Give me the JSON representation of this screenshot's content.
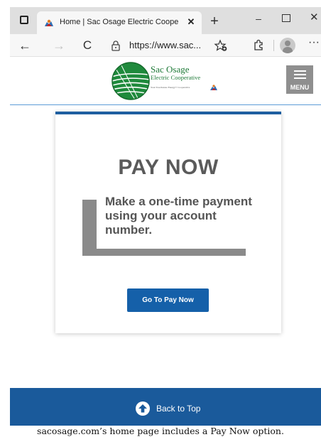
{
  "browser": {
    "tab_title": "Home | Sac Osage Electric Coope",
    "tab_close": "✕",
    "new_tab": "+",
    "minimize": "–",
    "close_window": "✕",
    "back": "←",
    "forward": "→",
    "refresh": "C",
    "url": "https://www.sac...",
    "more": "···"
  },
  "site": {
    "logo_name": "Sac Osage",
    "logo_subtitle": "Electric Cooperative",
    "logo_tagline": "Your Touchstone Energy® Cooperative",
    "menu_label": "MENU",
    "accent_color": "#1e5fa0"
  },
  "pay_card": {
    "title": "PAY NOW",
    "description": "Make a one-time payment using your account number.",
    "button_label": "Go To Pay Now"
  },
  "footer": {
    "back_to_top": "Back to Top"
  },
  "caption": "sacosage.com’s home page includes a Pay Now option."
}
